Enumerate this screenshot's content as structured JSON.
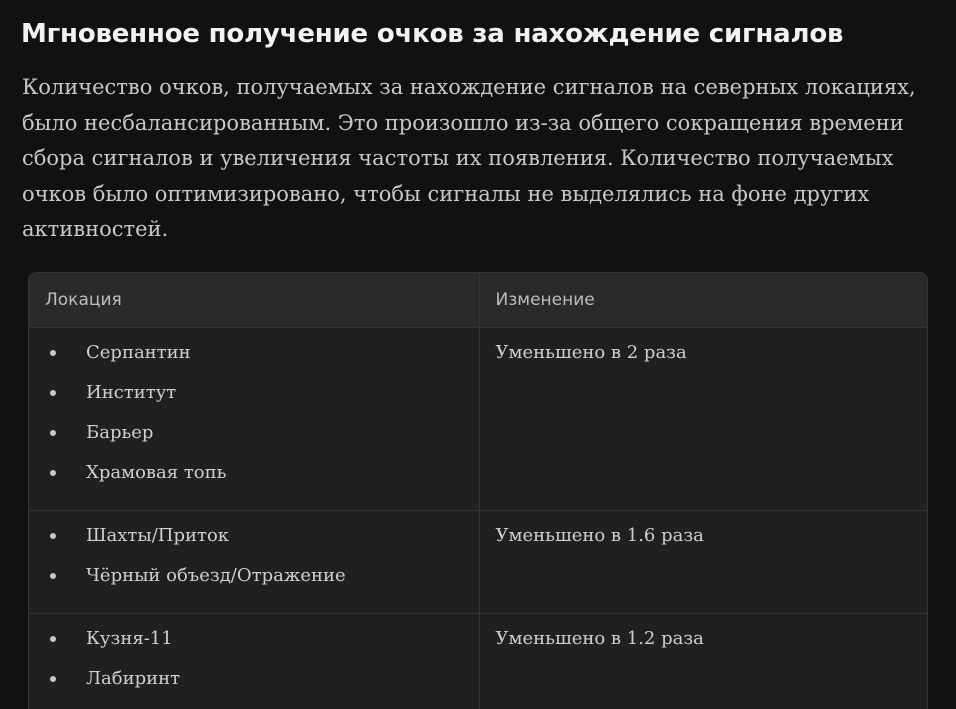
{
  "heading": "Мгновенное получение очков за нахождение сигналов",
  "description": "Количество очков, получаемых за нахождение сигналов на северных локациях, было несбалансированным. Это произошло из-за общего сокращения времени сбора сигналов и увеличения частоты их появления. Количество получаемых очков было оптимизировано, чтобы сигналы не выделялись на фоне других активностей.",
  "table": {
    "headers": [
      "Локация",
      "Изменение"
    ],
    "rows": [
      {
        "locations": [
          "Серпантин",
          "Институт",
          "Барьер",
          "Храмовая топь"
        ],
        "change": "Уменьшено в 2 раза"
      },
      {
        "locations": [
          "Шахты/Приток",
          "Чёрный объезд/Отражение"
        ],
        "change": "Уменьшено в 1.6 раза"
      },
      {
        "locations": [
          "Кузня-11",
          "Лабиринт"
        ],
        "change": "Уменьшено в 1.2 раза"
      }
    ]
  },
  "colors": {
    "background": "#111111",
    "table_background": "#202020",
    "table_header_background": "#2a2a2a",
    "border": "#353535",
    "text": "#cfcfcf"
  }
}
